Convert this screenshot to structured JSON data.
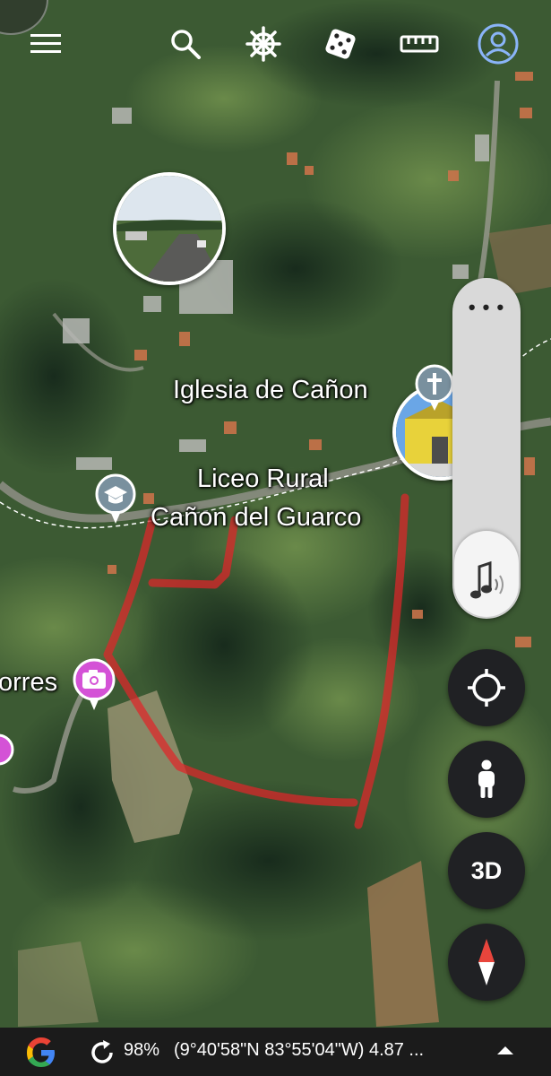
{
  "map": {
    "labels": [
      {
        "name": "iglesia-label",
        "text": "Iglesia de Cañon"
      },
      {
        "name": "liceo-label-line1",
        "text": "Liceo Rural"
      },
      {
        "name": "liceo-label-line2",
        "text": "Cañon del Guarco"
      },
      {
        "name": "torres-label",
        "text": "orres"
      }
    ],
    "pins": {
      "church_icon": "cross-icon",
      "school_icon": "graduation-cap-icon",
      "photo_icon": "camera-plus-icon"
    },
    "boundary_color": "#e0262a"
  },
  "toolbar": {
    "icons": [
      "menu-icon",
      "search-icon",
      "ship-wheel-icon",
      "dice-icon",
      "ruler-icon",
      "account-icon"
    ]
  },
  "controls": {
    "slider_dots": "• • •",
    "audio_icon": "music-note-icon",
    "locate_icon": "crosshair-icon",
    "streetview_icon": "pegman-icon",
    "three_d_label": "3D",
    "compass_icon": "compass-icon"
  },
  "status": {
    "logo": "google-g-icon",
    "refresh_icon": "refresh-icon",
    "percent": "98%",
    "coords": "(9°40'58\"N 83°55'04\"W) 4.87 ...",
    "expand_icon": "chevron-up-icon"
  }
}
